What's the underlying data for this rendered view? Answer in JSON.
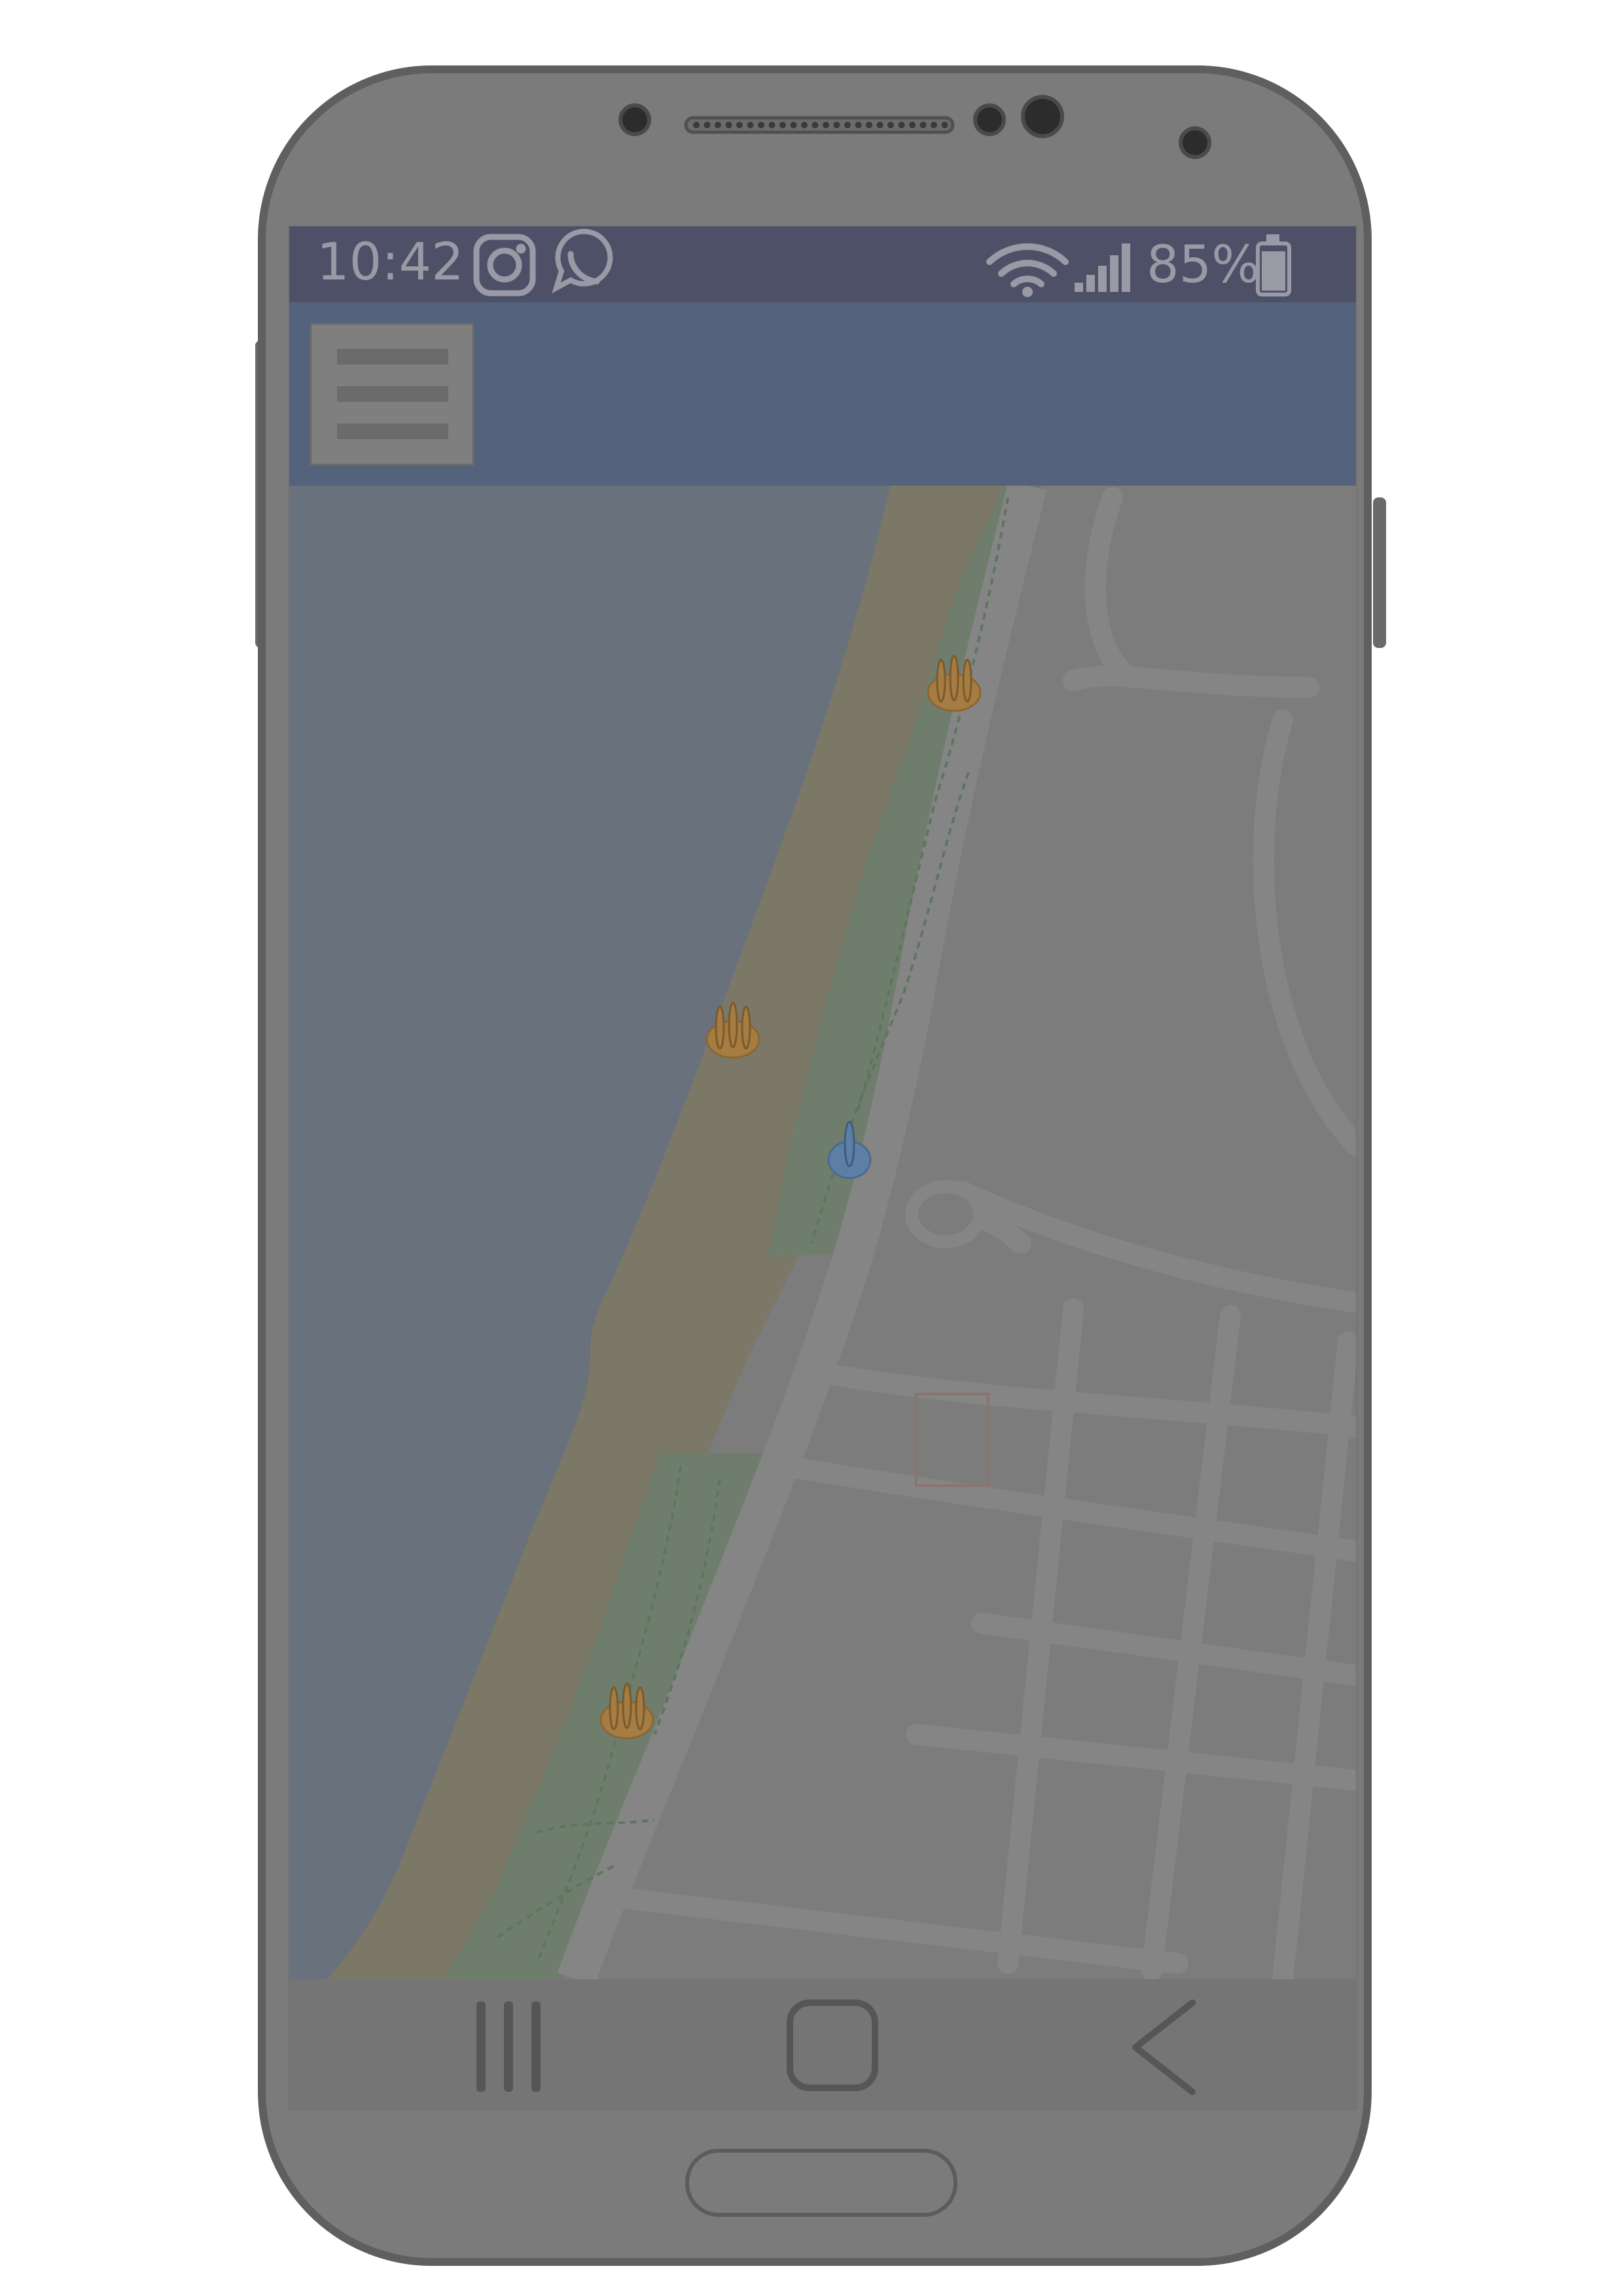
{
  "status_bar": {
    "time": "10:42",
    "battery_percent": "85%",
    "notification_icons": [
      "instagram-icon",
      "whatsapp-icon"
    ],
    "system_icons": [
      "wifi-icon",
      "signal-icon",
      "battery-icon"
    ]
  },
  "app_bar": {
    "menu_icon": "hamburger-menu-icon"
  },
  "map": {
    "markers": [
      {
        "type": "beach-hand-icon"
      },
      {
        "type": "beach-hand-icon"
      },
      {
        "type": "location-pin-icon"
      },
      {
        "type": "beach-hand-icon"
      }
    ]
  },
  "nav_bar": {
    "buttons": [
      "recents-icon",
      "home-icon",
      "back-icon"
    ]
  },
  "colors": {
    "phone_body": "#7b7b7b",
    "status_bar": "#4e5068",
    "app_bar": "#54627b",
    "sea": "#69717c",
    "sand": "#7b7868",
    "park": "#6f7e6c",
    "city": "#7c7c7c",
    "road": "#858585",
    "beach_marker": "#a57c41",
    "pin_marker": "#5d7fa4"
  }
}
